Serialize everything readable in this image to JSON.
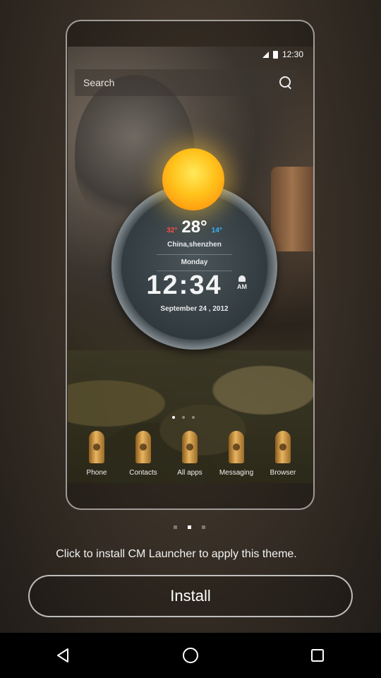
{
  "status_bar": {
    "time": "12:30"
  },
  "preview": {
    "search_label": "Search",
    "weather": {
      "high": "32°",
      "current": "28°",
      "low": "14°",
      "city": "China,shenzhen",
      "day": "Monday",
      "time": "12:34",
      "ampm": "AM",
      "date": "September 24 , 2012"
    },
    "dock": [
      {
        "label": "Phone",
        "icon": "phone-bullet-icon"
      },
      {
        "label": "Contacts",
        "icon": "contacts-bullet-icon"
      },
      {
        "label": "All apps",
        "icon": "all-apps-bullet-icon"
      },
      {
        "label": "Messaging",
        "icon": "messaging-bullet-icon"
      },
      {
        "label": "Browser",
        "icon": "browser-bullet-icon"
      }
    ]
  },
  "install_prompt": "Click to install CM Launcher to apply this theme.",
  "install_button": "Install",
  "colors": {
    "high_temp": "#ff4a4a",
    "low_temp": "#36b5ff",
    "sun": "#ffc21b"
  }
}
